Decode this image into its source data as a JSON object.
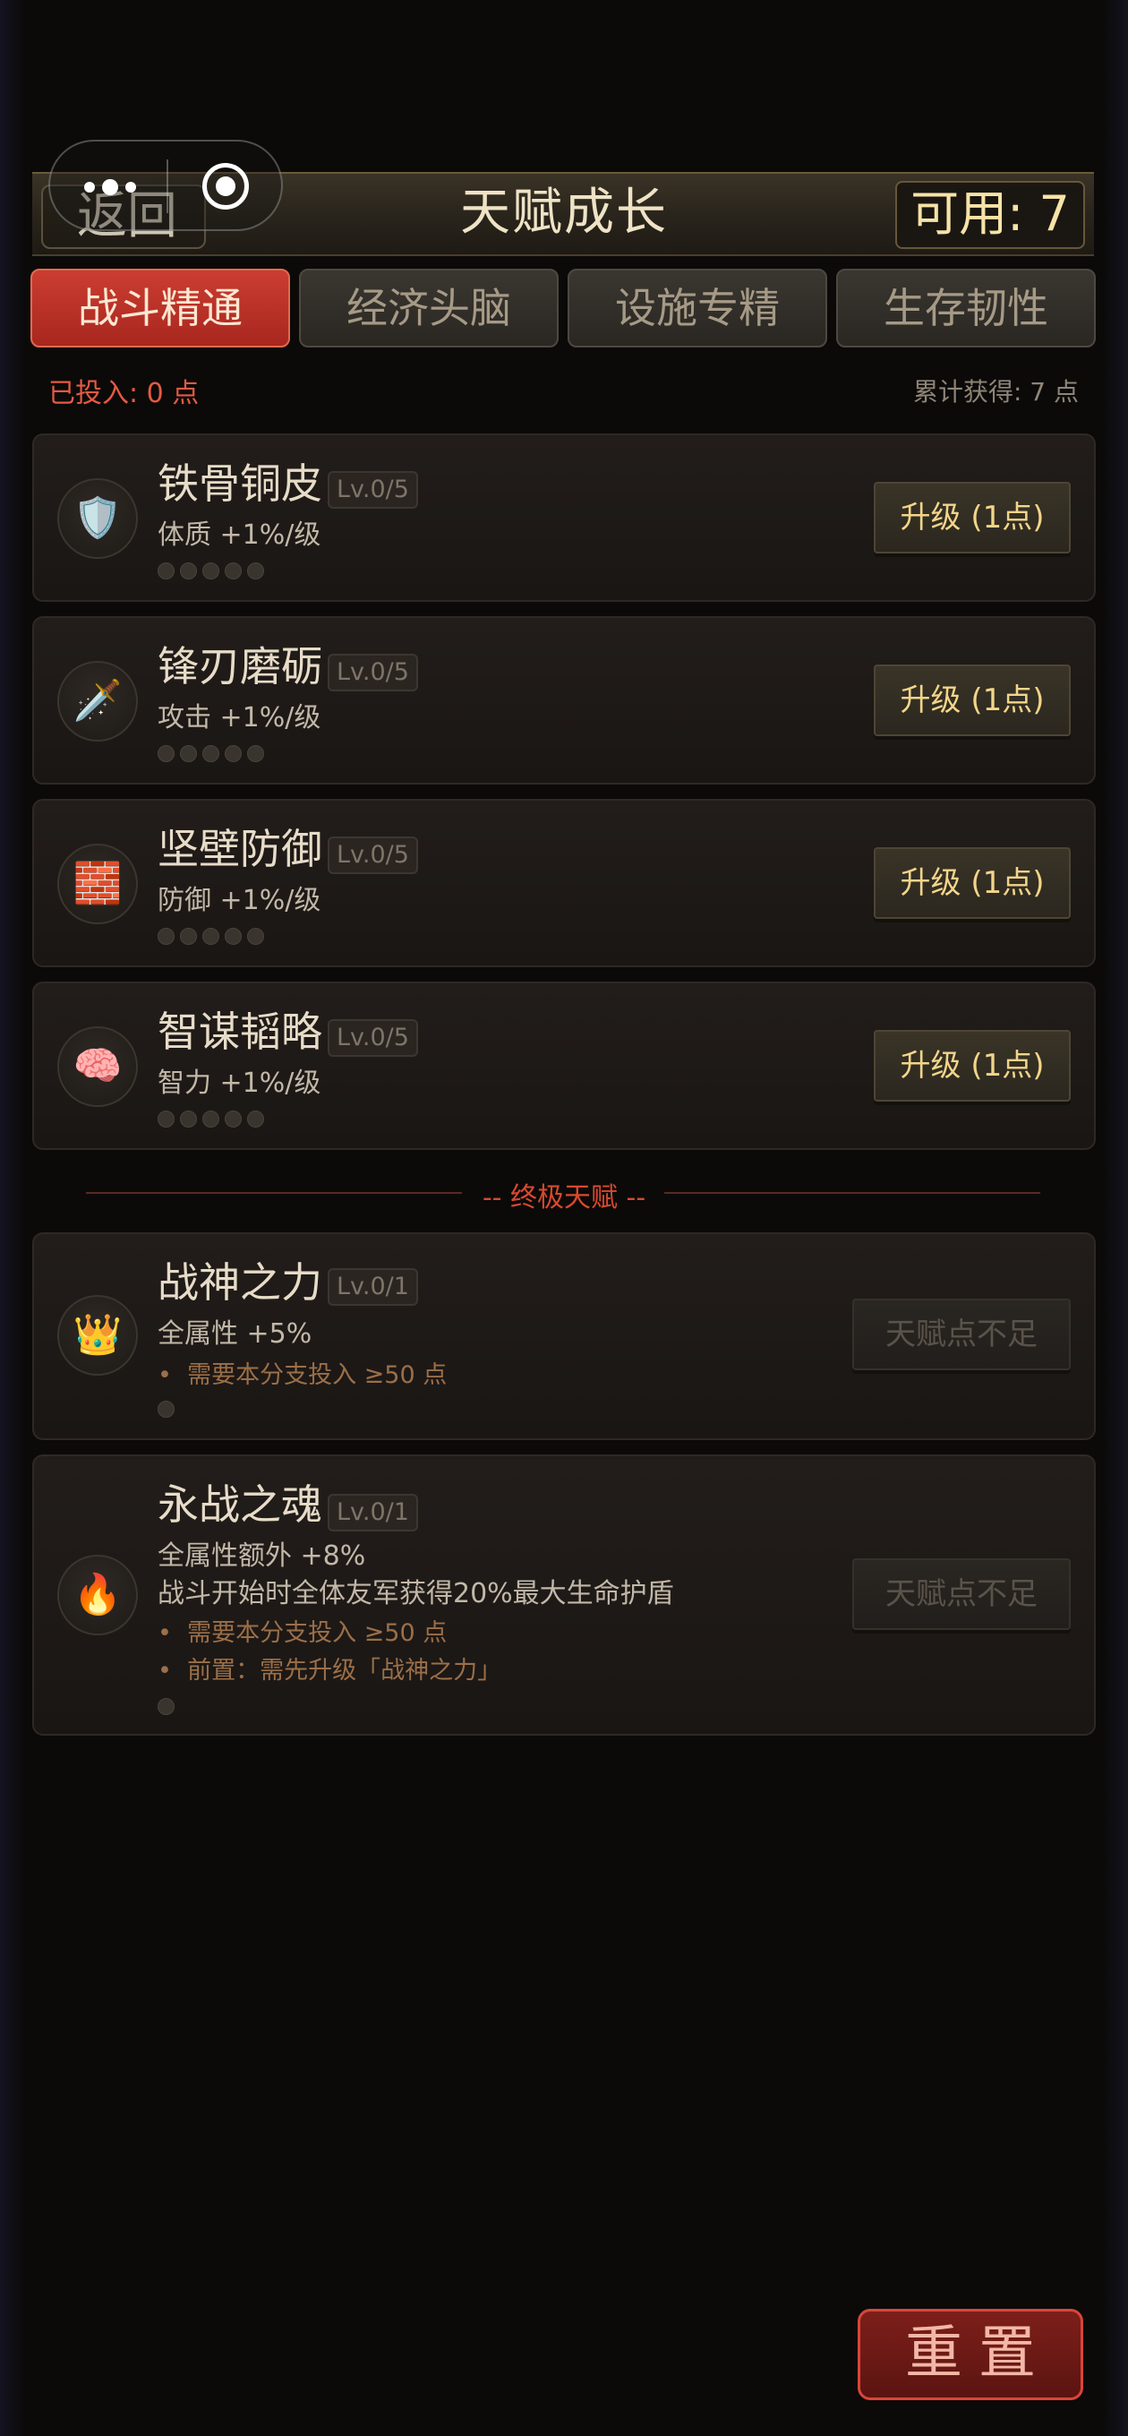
{
  "header": {
    "back_label": "返回",
    "title": "天赋成长",
    "available": "可用: 7"
  },
  "tabs": [
    {
      "label": "战斗精通",
      "active": true
    },
    {
      "label": "经济头脑",
      "active": false
    },
    {
      "label": "设施专精",
      "active": false
    },
    {
      "label": "生存韧性",
      "active": false
    }
  ],
  "stats": {
    "invested": "已投入: 0 点",
    "earned": "累计获得: 7 点"
  },
  "talents": [
    {
      "icon": "shield-icon",
      "glyph": "🛡️",
      "name": "铁骨铜皮",
      "level": "Lv.0/5",
      "desc": "体质 +1%/级",
      "button": "升级 (1点)"
    },
    {
      "icon": "dagger-icon",
      "glyph": "🗡️",
      "name": "锋刃磨砺",
      "level": "Lv.0/5",
      "desc": "攻击 +1%/级",
      "button": "升级 (1点)"
    },
    {
      "icon": "brick-icon",
      "glyph": "🧱",
      "name": "坚壁防御",
      "level": "Lv.0/5",
      "desc": "防御 +1%/级",
      "button": "升级 (1点)"
    },
    {
      "icon": "brain-icon",
      "glyph": "🧠",
      "name": "智谋韬略",
      "level": "Lv.0/5",
      "desc": "智力 +1%/级",
      "button": "升级 (1点)"
    }
  ],
  "ultimate_label": "-- 终极天赋 --",
  "ultimates": [
    {
      "icon": "crown-icon",
      "glyph": "👑",
      "name": "战神之力",
      "level": "Lv.0/1",
      "desc": [
        "全属性 +5%"
      ],
      "requirements": [
        "需要本分支投入 ≥50 点"
      ],
      "button": "天赋点不足"
    },
    {
      "icon": "fire-icon",
      "glyph": "🔥",
      "name": "永战之魂",
      "level": "Lv.0/1",
      "desc": [
        "全属性额外 +8%",
        "战斗开始时全体友军获得20%最大生命护盾"
      ],
      "requirements": [
        "需要本分支投入 ≥50 点",
        "前置：需先升级「战神之力」"
      ],
      "button": "天赋点不足"
    }
  ],
  "reset_label": "重置"
}
